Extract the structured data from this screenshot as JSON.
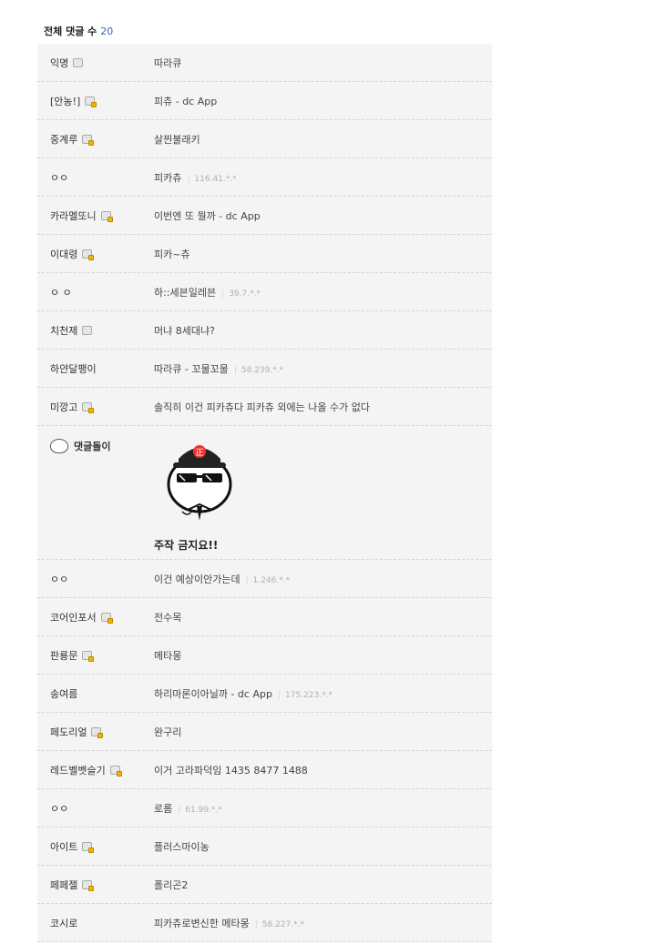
{
  "header": {
    "label": "전체 댓글 수",
    "count": "20"
  },
  "comments": [
    {
      "nick": "익명",
      "icon": "gallery-icon",
      "text": "따라큐",
      "ip": ""
    },
    {
      "nick": "[안농!]",
      "icon": "fixed-gallery-icon",
      "text": "피츄 - dc App",
      "ip": ""
    },
    {
      "nick": "중계루",
      "icon": "fixed-gallery-icon",
      "text": "살찐불래키",
      "ip": ""
    },
    {
      "nick": "ㅇㅇ",
      "icon": "",
      "text": "피카츄",
      "ip": "116.41.*.*"
    },
    {
      "nick": "카라멜또니",
      "icon": "fixed-gallery-icon",
      "text": "이번엔 또 뭘까 - dc App",
      "ip": ""
    },
    {
      "nick": "이대령",
      "icon": "fixed-gallery-icon",
      "text": "피카~츄",
      "ip": ""
    },
    {
      "nick": "ㅇ ㅇ",
      "icon": "",
      "text": "하::세븐일레븐",
      "ip": "39.7.*.*"
    },
    {
      "nick": "치천제",
      "icon": "gallery-icon",
      "text": "머냐 8세대냐?",
      "ip": ""
    },
    {
      "nick": "하얀달팽이",
      "icon": "",
      "text": "따라큐 - 꼬물꼬물",
      "ip": "58.239.*.*"
    },
    {
      "nick": "미깡고",
      "icon": "fixed-gallery-icon",
      "text": "솔직히 이건 피카츄다 피카츄 외에는 나올 수가 없다",
      "ip": ""
    }
  ],
  "dcbot": {
    "nick": "댓글돌이",
    "icon": "dcbot-icon",
    "caption": "주작 금지요!!"
  },
  "comments2": [
    {
      "nick": "ㅇㅇ",
      "icon": "",
      "text": "이건 예상이안가는데",
      "ip": "1.246.*.*"
    },
    {
      "nick": "코어인포서",
      "icon": "fixed-gallery-icon",
      "text": "전수목",
      "ip": ""
    },
    {
      "nick": "판룡문",
      "icon": "fixed-gallery-icon",
      "text": "메타몽",
      "ip": ""
    },
    {
      "nick": "송여름",
      "icon": "",
      "text": "하리마론이아닐까 - dc App",
      "ip": "175.223.*.*"
    },
    {
      "nick": "페도리얼",
      "icon": "fixed-gallery-icon",
      "text": "완구리",
      "ip": ""
    },
    {
      "nick": "레드벨벳슬기",
      "icon": "fixed-gallery-icon",
      "text": "이거 고라파덕임 1435 8477 1488",
      "ip": ""
    },
    {
      "nick": "ㅇㅇ",
      "icon": "",
      "text": "로롬",
      "ip": "61.99.*.*"
    },
    {
      "nick": "아이트",
      "icon": "fixed-gallery-icon",
      "text": "플러스마이농",
      "ip": ""
    },
    {
      "nick": "페페젤",
      "icon": "fixed-gallery-icon",
      "text": "폴리곤2",
      "ip": ""
    },
    {
      "nick": "코시로",
      "icon": "",
      "text": "피카츄로변신한 메타몽",
      "ip": "58.227.*.*"
    }
  ]
}
